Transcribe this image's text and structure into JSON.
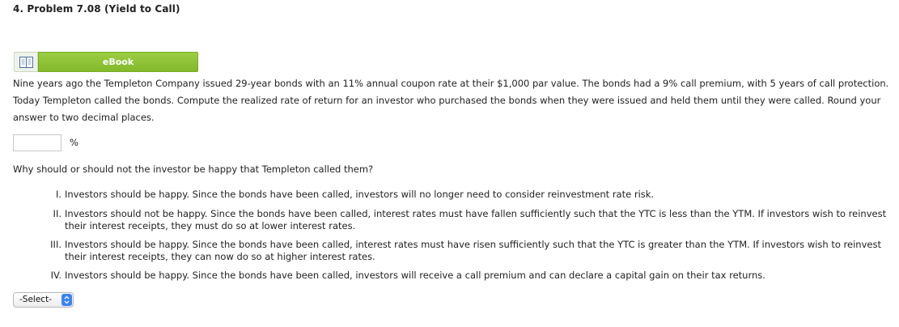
{
  "problem": {
    "title": "4.  Problem 7.08 (Yield to Call)"
  },
  "ebook": {
    "label": "eBook",
    "icon": "book-icon"
  },
  "question": {
    "paragraph": "Nine years ago the Templeton Company issued 29-year bonds with an 11% annual coupon rate at their $1,000 par value. The bonds had a 9% call premium, with 5 years of call protection. Today Templeton called the bonds. Compute the realized rate of return for an investor who purchased the bonds when they were issued and held them until they were called. Round your answer to two decimal places.",
    "answer_value": "",
    "unit": "%",
    "followup": "Why should or should not the investor be happy that Templeton called them?"
  },
  "options": [
    {
      "numeral": "I.",
      "text": "Investors should be happy. Since the bonds have been called, investors will no longer need to consider reinvestment rate risk."
    },
    {
      "numeral": "II.",
      "text": "Investors should not be happy. Since the bonds have been called, interest rates must have fallen sufficiently such that the YTC is less than the YTM. If investors wish to reinvest their interest receipts, they must do so at lower interest rates."
    },
    {
      "numeral": "III.",
      "text": "Investors should be happy. Since the bonds have been called, interest rates must have risen sufficiently such that the YTC is greater than the YTM. If investors wish to reinvest their interest receipts, they can now do so at higher interest rates."
    },
    {
      "numeral": "IV.",
      "text": "Investors should be happy. Since the bonds have been called, investors will receive a call premium and can declare a capital gain on their tax returns."
    }
  ],
  "select": {
    "selected": "-Select-"
  },
  "colors": {
    "ebook_green": "#8bc53f",
    "select_arrow_blue": "#3b82f6"
  }
}
